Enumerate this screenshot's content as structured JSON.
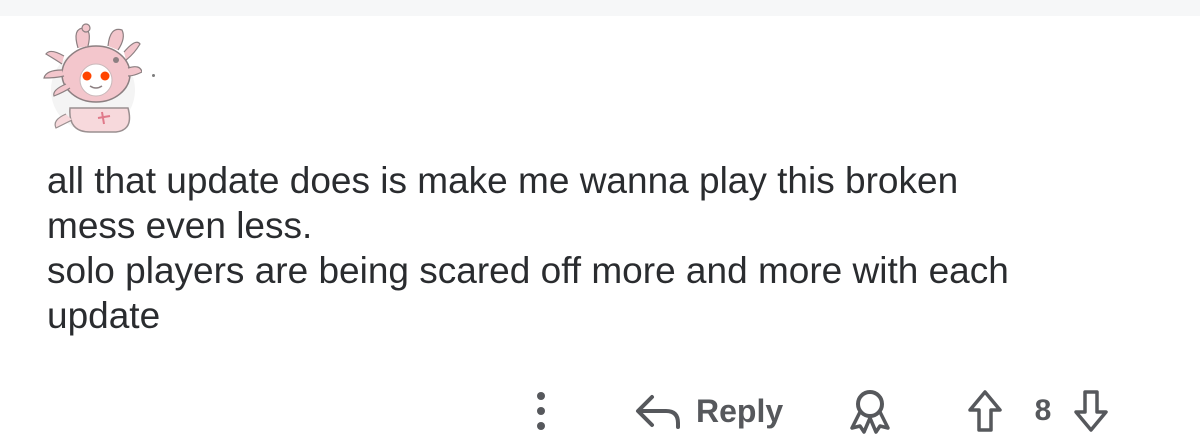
{
  "comment": {
    "body_lines": [
      "all that update does is make me wanna play this broken",
      "mess even less.",
      "solo players are being scared off more and more with each",
      "update"
    ],
    "avatar_icon": "axolotl-snoo-avatar-icon"
  },
  "actions": {
    "more_icon": "vertical-dots-icon",
    "reply_icon": "reply-arrow-icon",
    "reply_label": "Reply",
    "award_icon": "award-ribbon-icon",
    "upvote_icon": "upvote-arrow-icon",
    "vote_count": "8",
    "downvote_icon": "downvote-arrow-icon"
  },
  "colors": {
    "text": "#2a2c2f",
    "action_gray": "#56585c",
    "avatar_pink": "#f3c6cc",
    "avatar_eye": "#ff4500"
  }
}
